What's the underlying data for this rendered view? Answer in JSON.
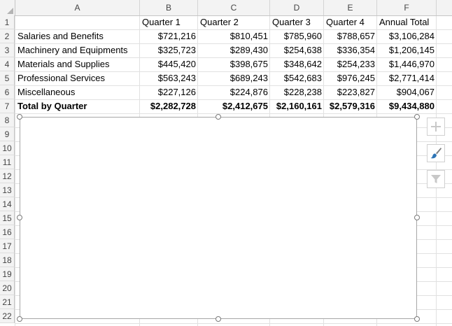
{
  "columns": [
    "A",
    "B",
    "C",
    "D",
    "E",
    "F"
  ],
  "rows": [
    "1",
    "2",
    "3",
    "4",
    "5",
    "6",
    "7",
    "8",
    "9",
    "10",
    "11",
    "12",
    "13",
    "14",
    "15",
    "16",
    "17",
    "18",
    "19",
    "20",
    "21",
    "22"
  ],
  "header": {
    "b": "Quarter 1",
    "c": "Quarter 2",
    "d": "Quarter 3",
    "e": "Quarter 4",
    "f": "Annual Total"
  },
  "data_rows": [
    {
      "label": "Salaries and Benefits",
      "q1": "$721,216",
      "q2": "$810,451",
      "q3": "$785,960",
      "q4": "$788,657",
      "total": "$3,106,284"
    },
    {
      "label": "Machinery and Equipments",
      "q1": "$325,723",
      "q2": "$289,430",
      "q3": "$254,638",
      "q4": "$336,354",
      "total": "$1,206,145"
    },
    {
      "label": "Materials and Supplies",
      "q1": "$445,420",
      "q2": "$398,675",
      "q3": "$348,642",
      "q4": "$254,233",
      "total": "$1,446,970"
    },
    {
      "label": "Professional Services",
      "q1": "$563,243",
      "q2": "$689,243",
      "q3": "$542,683",
      "q4": "$976,245",
      "total": "$2,771,414"
    },
    {
      "label": "Miscellaneous",
      "q1": "$227,126",
      "q2": "$224,876",
      "q3": "$228,238",
      "q4": "$223,827",
      "total": "$904,067"
    },
    {
      "label": "Total by Quarter",
      "q1": "$2,282,728",
      "q2": "$2,412,675",
      "q3": "$2,160,161",
      "q4": "$2,579,316",
      "total": "$9,434,880"
    }
  ],
  "chart_tools": {
    "add_elements_icon": "plus-icon",
    "styles_icon": "paintbrush-icon",
    "filters_icon": "filter-icon"
  },
  "colors": {
    "header_bg": "#f3f3f3",
    "grid": "#e1e1e1",
    "chart_border": "#a6a6a6",
    "tool_icon": "#c8c8c8",
    "brush_blue": "#2e75b6"
  }
}
